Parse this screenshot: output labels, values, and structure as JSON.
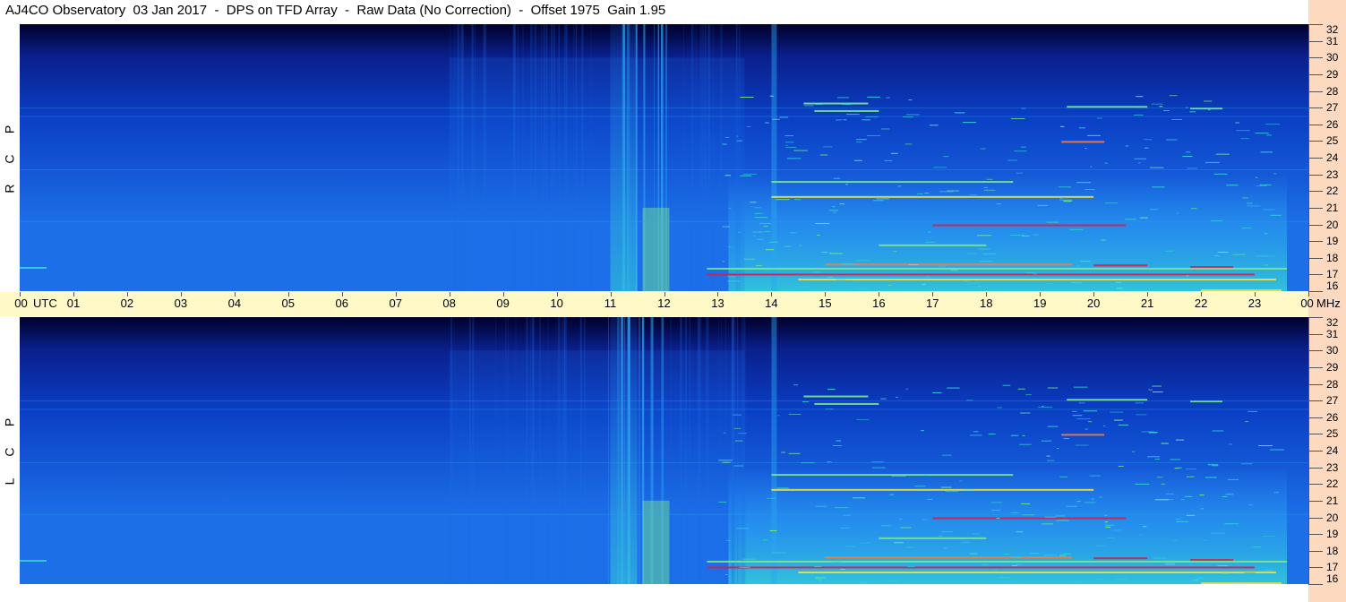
{
  "title": "AJ4CO Observatory  03 Jan 2017  -  DPS on TFD Array  -  Raw Data (No Correction)  -  Offset 1975  Gain 1.95",
  "chart_data": {
    "type": "heatmap",
    "title": "AJ4CO Observatory  03 Jan 2017  -  DPS on TFD Array  -  Raw Data (No Correction)  -  Offset 1975  Gain 1.95",
    "xlabel": "UTC",
    "ylabel": "MHz",
    "x_ticks": [
      "00",
      "01",
      "02",
      "03",
      "04",
      "05",
      "06",
      "07",
      "08",
      "09",
      "10",
      "11",
      "12",
      "13",
      "14",
      "15",
      "16",
      "17",
      "18",
      "19",
      "20",
      "21",
      "22",
      "23",
      "00"
    ],
    "y_ticks": [
      16,
      17,
      18,
      19,
      20,
      21,
      22,
      23,
      24,
      25,
      26,
      27,
      28,
      29,
      30,
      31,
      32
    ],
    "xlim": [
      0,
      24
    ],
    "ylim": [
      16,
      32
    ],
    "panels": [
      {
        "name": "R C P",
        "letters": [
          "R",
          "C",
          "P"
        ]
      },
      {
        "name": "L C P",
        "letters": [
          "L",
          "C",
          "P"
        ]
      }
    ],
    "colormap": [
      "#00002a",
      "#0a1f8c",
      "#0a3fc4",
      "#1d6fe8",
      "#2aa6f0",
      "#35d0d8",
      "#7be88c",
      "#f0e040",
      "#f08040",
      "#d02050"
    ]
  },
  "labels": {
    "utc": "UTC",
    "mhz": "MHz"
  }
}
